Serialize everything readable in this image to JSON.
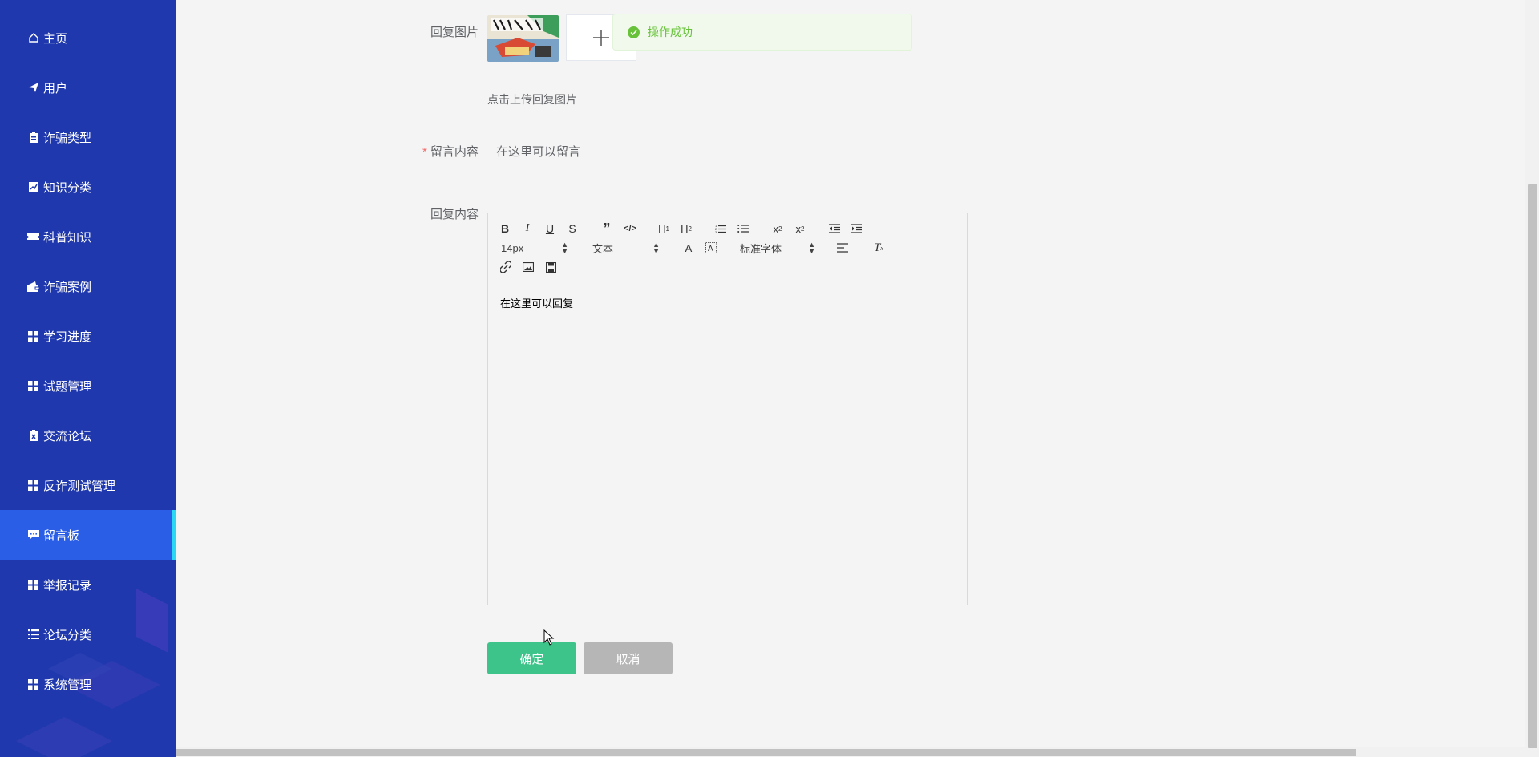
{
  "sidebar": {
    "items": [
      {
        "label": "主页",
        "icon": "home-icon"
      },
      {
        "label": "用户",
        "icon": "paper-plane-icon"
      },
      {
        "label": "诈骗类型",
        "icon": "clipboard-icon"
      },
      {
        "label": "知识分类",
        "icon": "chart-icon"
      },
      {
        "label": "科普知识",
        "icon": "ticket-icon"
      },
      {
        "label": "诈骗案例",
        "icon": "wallet-icon"
      },
      {
        "label": "学习进度",
        "icon": "grid-icon"
      },
      {
        "label": "试题管理",
        "icon": "grid-icon"
      },
      {
        "label": "交流论坛",
        "icon": "clipboard-x-icon"
      },
      {
        "label": "反诈测试管理",
        "icon": "grid-icon"
      },
      {
        "label": "留言板",
        "icon": "message-icon"
      },
      {
        "label": "举报记录",
        "icon": "grid-icon"
      },
      {
        "label": "论坛分类",
        "icon": "list-icon"
      },
      {
        "label": "系统管理",
        "icon": "grid-icon"
      }
    ],
    "active_index": 10,
    "bg_color": "#1f38ad",
    "active_color": "#2a5ee6"
  },
  "form": {
    "reply_image_label": "回复图片",
    "upload_hint": "点击上传回复图片",
    "message_label": "留言内容",
    "message_value": "在这里可以留言",
    "reply_content_label": "回复内容"
  },
  "editor": {
    "font_size": "14px",
    "paragraph": "文本",
    "font_family": "标准字体",
    "content": "在这里可以回复"
  },
  "buttons": {
    "ok": "确定",
    "cancel": "取消"
  },
  "toast": {
    "message": "操作成功",
    "color": "#67c23a"
  }
}
